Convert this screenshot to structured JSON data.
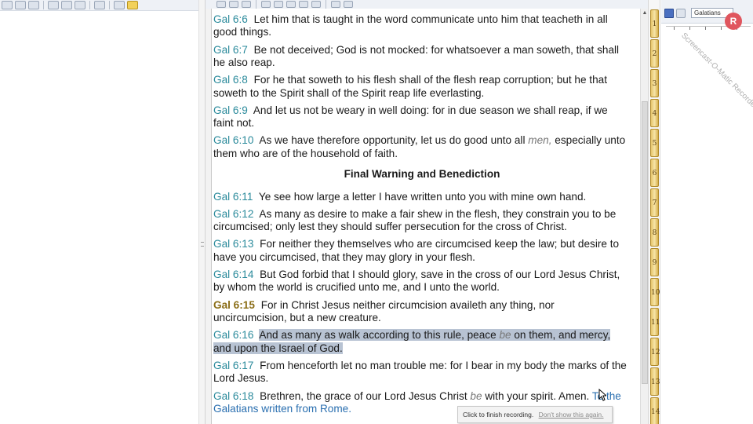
{
  "colors": {
    "reference": "#2a8a9b",
    "current_reference": "#8a6d16",
    "highlight": "#b8c3d3",
    "subscript": "#2a6fb0",
    "book_tab": "#e6c56a"
  },
  "left_toolbar": {
    "icons": [
      "back-icon",
      "forward-icon",
      "sync-icon",
      "note-icon",
      "tag-icon",
      "search-icon",
      "library-icon",
      "link-icon"
    ]
  },
  "center_toolbar": {
    "icons": [
      "play-icon",
      "copy-icon",
      "print-icon",
      "find-icon",
      "bookmark-icon",
      "zoom-icon",
      "copy-verse-icon",
      "paste-icon",
      "nav-back-icon",
      "nav-forward-icon"
    ]
  },
  "text": {
    "verses_before_heading": [
      {
        "ref": "Gal 6:6",
        "text": "Let him that is taught in the word communicate unto him that teacheth in all good things."
      },
      {
        "ref": "Gal 6:7",
        "text": "Be not deceived; God is not mocked: for whatsoever a man soweth, that shall he also reap."
      },
      {
        "ref": "Gal 6:8",
        "text": "For he that soweth to his flesh shall of the flesh reap corruption; but he that soweth to the Spirit shall of the Spirit reap life everlasting."
      },
      {
        "ref": "Gal 6:9",
        "text": "And let us not be weary in well doing: for in due season we shall reap, if we faint not."
      },
      {
        "ref": "Gal 6:10",
        "text_a": "As we have therefore opportunity, let us do good unto all",
        "italic": "men,",
        "text_b": "especially unto them who are of the household of faith."
      }
    ],
    "heading": "Final Warning and Benediction",
    "verses_after_heading": [
      {
        "ref": "Gal 6:11",
        "text": "Ye see how large a letter I have written unto you with mine own hand."
      },
      {
        "ref": "Gal 6:12",
        "text": "As many as desire to make a fair shew in the flesh, they constrain you to be circumcised; only lest they should suffer persecution for the cross of Christ."
      },
      {
        "ref": "Gal 6:13",
        "text": "For neither they themselves who are circumcised keep the law; but desire to have you circumcised, that they may glory in your flesh."
      },
      {
        "ref": "Gal 6:14",
        "text": "But God forbid that I should glory, save in the cross of our Lord Jesus Christ, by whom the world is crucified unto me, and I unto the world."
      },
      {
        "ref": "Gal 6:15",
        "text": "For in Christ Jesus neither circumcision availeth any thing, nor uncircumcision, but a new creature."
      },
      {
        "ref": "Gal 6:16",
        "text_a": "And as many as walk according to this rule, peace",
        "italic": "be",
        "text_b": "on them, and mercy, and upon the Israel of God."
      },
      {
        "ref": "Gal 6:17",
        "text": "From henceforth let no man trouble me: for I bear in my body the marks of the Lord Jesus."
      },
      {
        "ref": "Gal 6:18",
        "text_a": "Brethren, the grace of our Lord Jesus Christ",
        "italic": "be",
        "text_b": "with your spirit. Amen.",
        "subscript": "To the Galatians written from Rome."
      }
    ]
  },
  "book_tabs": [
    "1",
    "2",
    "3",
    "4",
    "5",
    "6",
    "7",
    "8",
    "9",
    "10",
    "11",
    "12",
    "13",
    "14"
  ],
  "right_toolbar": {
    "combo_value": "Galatians"
  },
  "recorder": {
    "watermark": "Screencast-O-Matic Recorder",
    "badge": "R"
  },
  "tooltip": {
    "text": "Click to finish recording.",
    "dismiss": "Don't show this again."
  }
}
